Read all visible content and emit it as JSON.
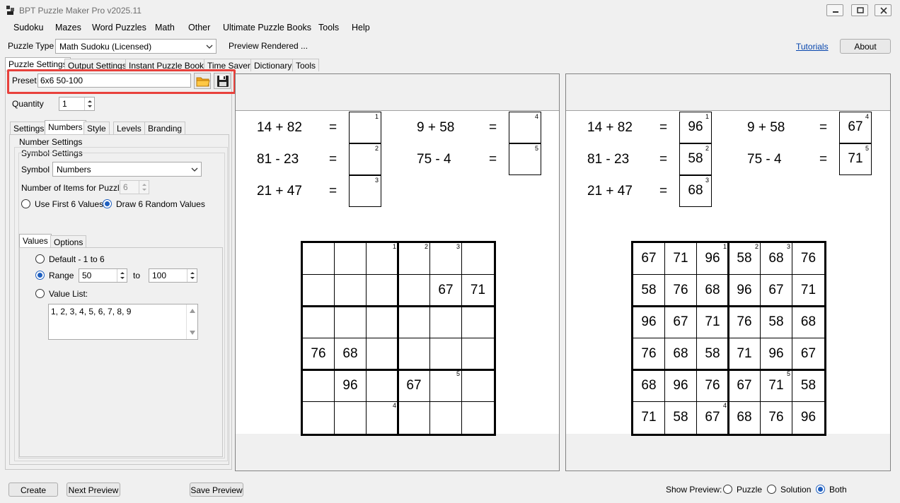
{
  "window": {
    "title": "BPT Puzzle Maker Pro v2025.11"
  },
  "menu": [
    "Sudoku",
    "Mazes",
    "Word Puzzles",
    "Math",
    "Other",
    "Ultimate Puzzle Books",
    "Tools",
    "Help"
  ],
  "toolbar": {
    "puzzle_type_label": "Puzzle Type",
    "puzzle_type_value": "Math Sudoku (Licensed)",
    "status": "Preview Rendered ...",
    "tutorials": "Tutorials",
    "about": "About"
  },
  "main_tabs": [
    "Puzzle Settings",
    "Output Settings",
    "Instant Puzzle Books",
    "Time Saver",
    "Dictionary",
    "Tools"
  ],
  "preset": {
    "label": "Preset",
    "value": "6x6 50-100"
  },
  "quantity": {
    "label": "Quantity",
    "value": "1"
  },
  "sub_tabs": [
    "Settings",
    "Numbers",
    "Style",
    "Levels",
    "Branding"
  ],
  "numbers": {
    "group_title": "Number Settings",
    "symbol_group": "Symbol Settings",
    "symbol_label": "Symbol",
    "symbol_value": "Numbers",
    "items_label": "Number of Items for Puzzle:",
    "items_value": "6",
    "use_first": "Use First 6 Values",
    "draw_random": "Draw 6 Random Values"
  },
  "values_tabs": [
    "Values",
    "Options"
  ],
  "values": {
    "default_label": "Default - 1 to 6",
    "range_label": "Range",
    "range_from": "50",
    "range_to_label": "to",
    "range_to": "100",
    "list_label": "Value List:",
    "list_value": "1, 2, 3, 4, 5, 6, 7, 8, 9"
  },
  "equations": [
    {
      "expr": "14 + 82",
      "eq": "=",
      "index": "1",
      "answer": "96"
    },
    {
      "expr": "81 - 23",
      "eq": "=",
      "index": "2",
      "answer": "58"
    },
    {
      "expr": "21 + 47",
      "eq": "=",
      "index": "3",
      "answer": "68"
    },
    {
      "expr": "9 + 58",
      "eq": "=",
      "index": "4",
      "answer": "67"
    },
    {
      "expr": "75 - 4",
      "eq": "=",
      "index": "5",
      "answer": "71"
    }
  ],
  "puzzle_grid": [
    [
      "",
      "",
      "",
      "",
      "",
      ""
    ],
    [
      "",
      "",
      "",
      "",
      "67",
      "71"
    ],
    [
      "",
      "",
      "",
      "",
      "",
      ""
    ],
    [
      "76",
      "68",
      "",
      "",
      "",
      ""
    ],
    [
      "",
      "96",
      "",
      "67",
      "",
      ""
    ],
    [
      "",
      "",
      "",
      "",
      "",
      ""
    ]
  ],
  "solution_grid": [
    [
      "67",
      "71",
      "96",
      "58",
      "68",
      "76"
    ],
    [
      "58",
      "76",
      "68",
      "96",
      "67",
      "71"
    ],
    [
      "96",
      "67",
      "71",
      "76",
      "58",
      "68"
    ],
    [
      "76",
      "68",
      "58",
      "71",
      "96",
      "67"
    ],
    [
      "68",
      "96",
      "76",
      "67",
      "71",
      "58"
    ],
    [
      "71",
      "58",
      "67",
      "68",
      "76",
      "96"
    ]
  ],
  "cell_markers": [
    {
      "row": 0,
      "col": 2,
      "label": "1"
    },
    {
      "row": 0,
      "col": 3,
      "label": "2"
    },
    {
      "row": 0,
      "col": 4,
      "label": "3"
    },
    {
      "row": 4,
      "col": 4,
      "label": "5"
    },
    {
      "row": 5,
      "col": 2,
      "label": "4"
    }
  ],
  "bottom": {
    "create": "Create",
    "next_preview": "Next Preview",
    "save_preview": "Save Preview",
    "show_preview_label": "Show Preview:",
    "options": [
      "Puzzle",
      "Solution",
      "Both"
    ],
    "selected": "Both"
  },
  "colors": {
    "highlight": "#e8413c",
    "accent": "#1f5fbf",
    "link": "#0645ad"
  }
}
